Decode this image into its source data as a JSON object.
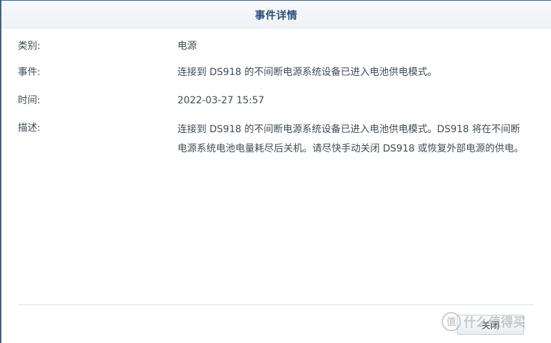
{
  "dialog": {
    "title": "事件详情",
    "fields": {
      "category": {
        "label": "类别:",
        "value": "电源"
      },
      "event": {
        "label": "事件:",
        "value": "连接到 DS918 的不间断电源系统设备已进入电池供电模式。"
      },
      "time": {
        "label": "时间:",
        "value": "2022-03-27 15:57"
      },
      "description": {
        "label": "描述:",
        "value": "连接到 DS918 的不间断电源系统设备已进入电池供电模式。DS918 将在不间断电源系统电池电量耗尽后关机。请尽快手动关闭 DS918 或恢复外部电源的供电。"
      }
    },
    "close_label": "关闭"
  },
  "watermark": {
    "text": "什么值得买",
    "icon": "值"
  },
  "colors": {
    "title": "#2b4f76",
    "text": "#414b55",
    "border": "#3a5f86"
  }
}
